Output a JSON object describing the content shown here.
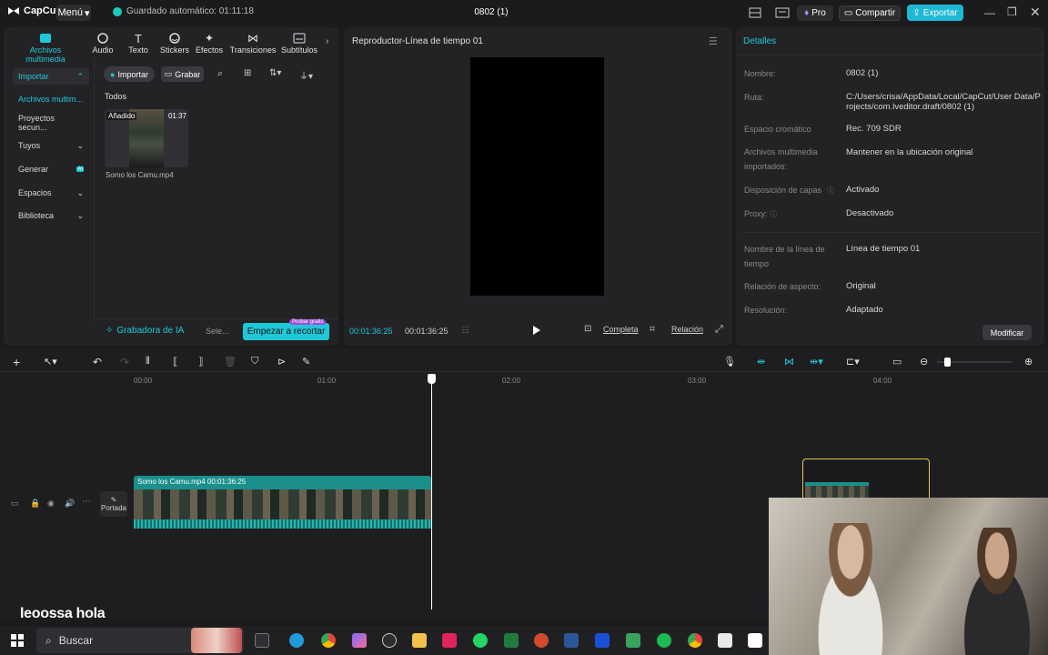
{
  "titlebar": {
    "app_name": "CapCut",
    "menu_label": "Menú",
    "autosave": "Guardado automático: 01:11:18",
    "project_title": "0802 (1)",
    "pro_label": "Pro",
    "share_label": "Compartir",
    "export_label": "Exportar"
  },
  "media_tabs": [
    {
      "label": "Archivos multimedia",
      "icon": "media-icon"
    },
    {
      "label": "Audio",
      "icon": "audio-icon"
    },
    {
      "label": "Texto",
      "icon": "text-icon"
    },
    {
      "label": "Stickers",
      "icon": "sticker-icon"
    },
    {
      "label": "Efectos",
      "icon": "effects-icon"
    },
    {
      "label": "Transiciones",
      "icon": "transition-icon"
    },
    {
      "label": "Subtítulos",
      "icon": "subtitle-icon"
    }
  ],
  "side_nav": {
    "importar": "Importar",
    "archivos": "Archivos multim...",
    "proyectos": "Proyectos secun...",
    "tuyos": "Tuyos",
    "generar": "Generar",
    "generar_badge": "AI",
    "espacios": "Espacios",
    "biblioteca": "Biblioteca"
  },
  "media": {
    "import_label": "Importar",
    "record_label": "Grabar",
    "all_label": "Todos",
    "clip": {
      "added_badge": "Añadido",
      "duration": "01:37",
      "name": "Somo los Camu.mp4"
    },
    "ai_recorder": "Grabadora de IA",
    "sele_label": "Sele...",
    "start_cut": "Empezar a recortar",
    "try_free": "Probar gratis"
  },
  "player": {
    "title": "Reproductor-Línea de tiempo 01",
    "time_current": "00:01:36:25",
    "time_total": "00:01:36:25",
    "full_label": "Completa",
    "ratio_label": "Relación"
  },
  "details": {
    "title": "Detalles",
    "rows": [
      {
        "label": "Nombre:",
        "value": "0802 (1)"
      },
      {
        "label": "Ruta:",
        "value": "C:/Users/crisa/AppData/Local/CapCut/User Data/Projects/com.lveditor.draft/0802 (1)"
      },
      {
        "label": "Espacio cromático",
        "value": "Rec. 709 SDR"
      },
      {
        "label": "Archivos multimedia importados:",
        "value": "Mantener en la ubicación original"
      },
      {
        "label": "Disposición de capas",
        "value": "Activado"
      },
      {
        "label": "Proxy:",
        "value": "Desactivado"
      },
      {
        "label": "Nombre de la línea de tiempo",
        "value": "Línea de tiempo 01"
      },
      {
        "label": "Relación de aspecto:",
        "value": "Original"
      },
      {
        "label": "Resolución:",
        "value": "Adaptado"
      }
    ],
    "modify_label": "Modificar"
  },
  "timeline": {
    "ticks": [
      "00:00",
      "01:00",
      "02:00",
      "03:00",
      "04:00"
    ],
    "clip_label": "Somo los Camu.mp4   00:01:36:25",
    "cover_label": "Portada"
  },
  "overlay_text": "leoossa  hola",
  "taskbar": {
    "search_placeholder": "Buscar"
  },
  "colors": {
    "accent": "#1fc8d7",
    "export": "#1fb8d4",
    "clip": "#1a8f8c",
    "background": "#1b1b1d",
    "panel": "#232326"
  }
}
